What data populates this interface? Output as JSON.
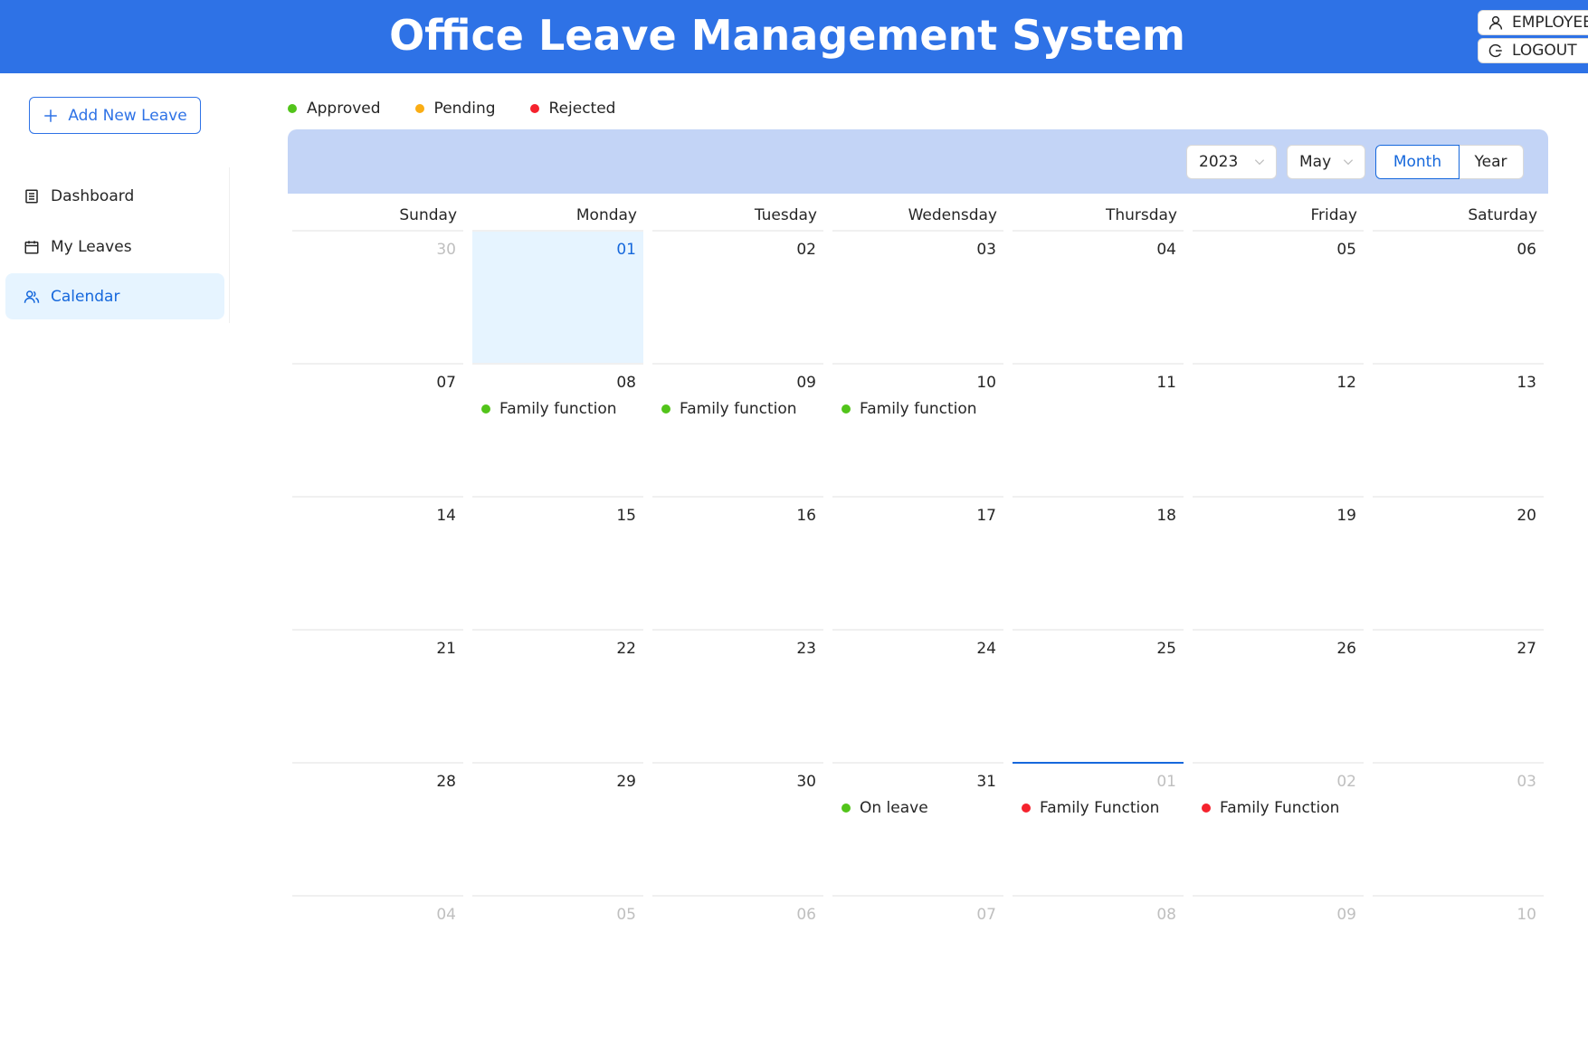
{
  "header": {
    "title": "Office Leave Management System"
  },
  "user_menu": {
    "employee_label": "EMPLOYEE",
    "logout_label": "LOGOUT"
  },
  "sidebar": {
    "add_button_label": "Add New Leave",
    "items": [
      {
        "label": "Dashboard",
        "icon": "dashboard-icon"
      },
      {
        "label": "My Leaves",
        "icon": "calendar-icon"
      },
      {
        "label": "Calendar",
        "icon": "team-icon",
        "active": true
      }
    ]
  },
  "legend": [
    {
      "label": "Approved",
      "color": "#52c41a"
    },
    {
      "label": "Pending",
      "color": "#faad14"
    },
    {
      "label": "Rejected",
      "color": "#f5222d"
    }
  ],
  "toolbar": {
    "year": "2023",
    "month": "May",
    "mode_month": "Month",
    "mode_year": "Year",
    "active_mode": "Month"
  },
  "calendar": {
    "weekdays": [
      "Sunday",
      "Monday",
      "Tuesday",
      "Wedensday",
      "Thursday",
      "Friday",
      "Saturday"
    ],
    "weeks": [
      [
        {
          "day": "30",
          "outside": true
        },
        {
          "day": "01",
          "today": true
        },
        {
          "day": "02"
        },
        {
          "day": "03"
        },
        {
          "day": "04"
        },
        {
          "day": "05"
        },
        {
          "day": "06"
        }
      ],
      [
        {
          "day": "07"
        },
        {
          "day": "08",
          "event": "Family function",
          "status": "approved"
        },
        {
          "day": "09",
          "event": "Family function",
          "status": "approved"
        },
        {
          "day": "10",
          "event": "Family function",
          "status": "approved"
        },
        {
          "day": "11"
        },
        {
          "day": "12"
        },
        {
          "day": "13"
        }
      ],
      [
        {
          "day": "14"
        },
        {
          "day": "15"
        },
        {
          "day": "16"
        },
        {
          "day": "17"
        },
        {
          "day": "18"
        },
        {
          "day": "19"
        },
        {
          "day": "20"
        }
      ],
      [
        {
          "day": "21"
        },
        {
          "day": "22"
        },
        {
          "day": "23"
        },
        {
          "day": "24"
        },
        {
          "day": "25"
        },
        {
          "day": "26"
        },
        {
          "day": "27"
        }
      ],
      [
        {
          "day": "28"
        },
        {
          "day": "29"
        },
        {
          "day": "30"
        },
        {
          "day": "31",
          "event": "On leave",
          "status": "approved"
        },
        {
          "day": "01",
          "outside": true,
          "selected": true,
          "event": "Family Function",
          "status": "rejected"
        },
        {
          "day": "02",
          "outside": true,
          "event": "Family Function",
          "status": "rejected"
        },
        {
          "day": "03",
          "outside": true
        }
      ],
      [
        {
          "day": "04",
          "outside": true
        },
        {
          "day": "05",
          "outside": true
        },
        {
          "day": "06",
          "outside": true
        },
        {
          "day": "07",
          "outside": true
        },
        {
          "day": "08",
          "outside": true
        },
        {
          "day": "09",
          "outside": true
        },
        {
          "day": "10",
          "outside": true
        }
      ]
    ]
  },
  "colors": {
    "primary": "#2e72e6",
    "link": "#1668dc",
    "toolbar_bg": "#c3d4f6",
    "today_bg": "#e6f4ff",
    "approved": "#52c41a",
    "pending": "#faad14",
    "rejected": "#f5222d"
  }
}
